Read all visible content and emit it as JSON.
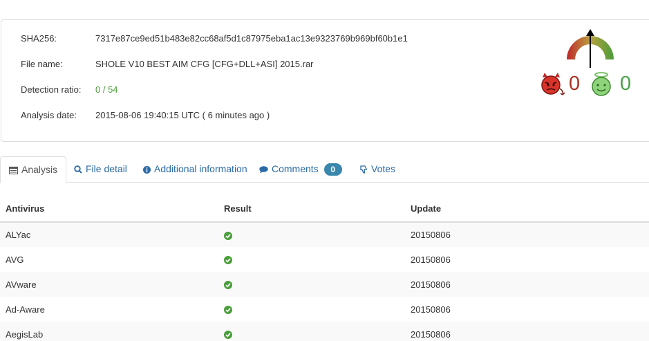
{
  "summary": {
    "sha256_label": "SHA256:",
    "sha256_value": "7317e87ce9ed51b483e82cc68af5d1c87975eba1ac13e9323769b969bf60b1e1",
    "filename_label": "File name:",
    "filename_value": "SHOLE V10 BEST AIM CFG [CFG+DLL+ASI] 2015.rar",
    "detection_label": "Detection ratio:",
    "detection_value": "0 / 54",
    "date_label": "Analysis date:",
    "date_value": "2015-08-06 19:40:15 UTC ( 6 minutes ago )"
  },
  "votes": {
    "malicious": "0",
    "harmless": "0",
    "gauge_icon": "reputation-gauge",
    "malicious_icon": "devil-icon",
    "harmless_icon": "angel-icon"
  },
  "tabs": [
    {
      "label": "Analysis",
      "icon": "list-icon",
      "active": true
    },
    {
      "label": "File detail",
      "icon": "search-icon"
    },
    {
      "label": "Additional information",
      "icon": "info-icon"
    },
    {
      "label": "Comments",
      "icon": "comment-icon",
      "badge": "0"
    },
    {
      "label": "Votes",
      "icon": "thumbs-down-icon"
    }
  ],
  "table": {
    "headers": [
      "Antivirus",
      "Result",
      "Update"
    ],
    "rows": [
      {
        "antivirus": "ALYac",
        "result": "clean",
        "update": "20150806"
      },
      {
        "antivirus": "AVG",
        "result": "clean",
        "update": "20150806"
      },
      {
        "antivirus": "AVware",
        "result": "clean",
        "update": "20150806"
      },
      {
        "antivirus": "Ad-Aware",
        "result": "clean",
        "update": "20150806"
      },
      {
        "antivirus": "AegisLab",
        "result": "clean",
        "update": "20150806"
      }
    ]
  },
  "colors": {
    "link": "#2a6aa6",
    "clean": "#4a9e3a",
    "malicious": "#a93226",
    "badge": "#3a87ad"
  }
}
